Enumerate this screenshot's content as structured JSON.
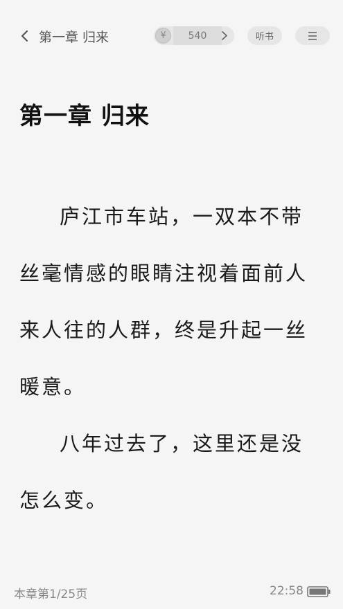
{
  "header": {
    "back_label": "第一章 归来",
    "coin_symbol": "¥",
    "coin_count": "540",
    "listen_label": "听书"
  },
  "content": {
    "chapter_title": "第一章 归来",
    "paragraphs": [
      "庐江市车站，一双本不带丝毫情感的眼睛注视着面前人来人往的人群，终是升起一丝暖意。",
      "八年过去了，这里还是没怎么变。"
    ]
  },
  "footer": {
    "page_info": "本章第1/25页",
    "time": "22:58"
  },
  "icons": {
    "back": "chevron-left-icon",
    "coin": "yuan-coin-icon",
    "forward": "chevron-right-icon",
    "menu": "hamburger-menu-icon",
    "battery": "battery-icon"
  },
  "colors": {
    "background": "#f5f5f5",
    "pill": "#e6e6e6",
    "muted_text": "#888888"
  }
}
